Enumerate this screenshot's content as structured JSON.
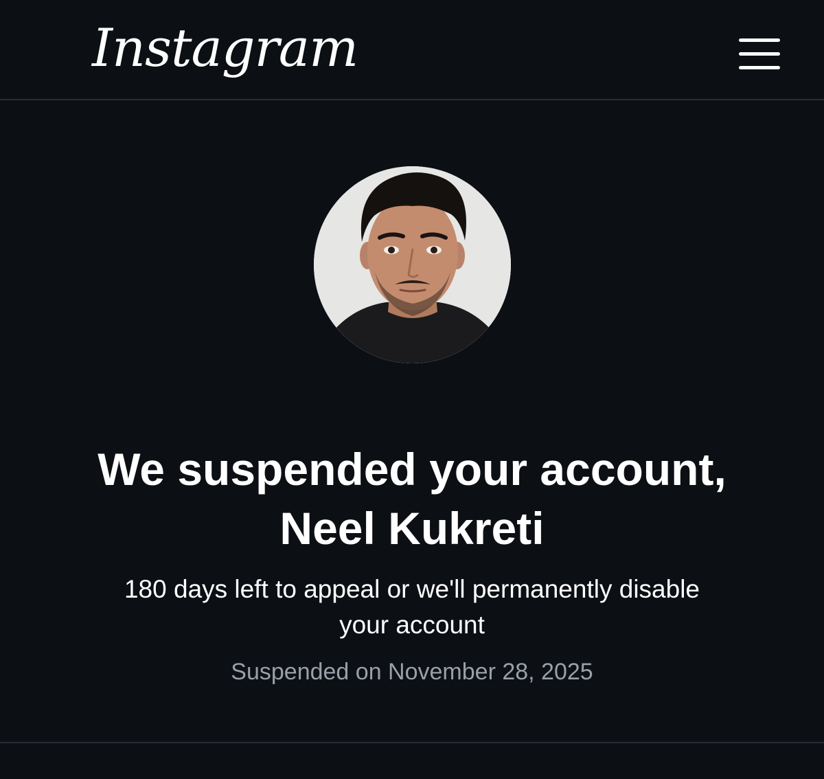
{
  "header": {
    "logo_text": "Instagram",
    "menu_icon": "hamburger-menu-icon"
  },
  "profile": {
    "avatar_icon": "profile-photo"
  },
  "main": {
    "headline": "We suspended your account, Neel Kukreti",
    "subtitle": "180 days left to appeal or we'll permanently disable your account",
    "suspended_date": "Suspended on November 28, 2025"
  },
  "colors": {
    "background": "#0c0f14",
    "text_primary": "#ffffff",
    "text_secondary": "#9aa0a8",
    "divider": "#2a2d33"
  }
}
